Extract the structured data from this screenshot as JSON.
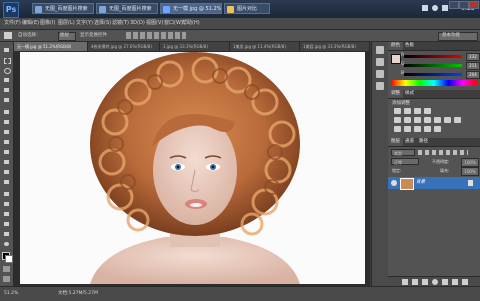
{
  "taskbar": {
    "app_logo": "Ps",
    "tabs": [
      {
        "label": "无图_百度图片搜索"
      },
      {
        "label": "无图_百度图片搜索"
      },
      {
        "label": "无一模 jpg @ 51.2%"
      },
      {
        "label": "图片对比"
      }
    ],
    "clock": "0:23"
  },
  "menubar": {
    "items": [
      "文件(F)",
      "编辑(E)",
      "图像(I)",
      "图层(L)",
      "文字(Y)",
      "选择(S)",
      "滤镜(T)",
      "3D(D)",
      "视图(V)",
      "窗口(W)",
      "帮助(H)"
    ]
  },
  "optbar": {
    "auto_select_label": "自动选择：",
    "auto_select_value": "图层",
    "transform_label": "显示变换控件",
    "workspace": "基本功能"
  },
  "doctabs": [
    {
      "label": "无一模.jpg @ 51.2%(RGB/8)",
      "active": true
    },
    {
      "label": "4卷发模特.jpg @ 27.6%(RGB/8)",
      "active": false
    },
    {
      "label": "1.jpg @ 33.3%(RGB/8)",
      "active": false
    },
    {
      "label": "1美发.jpg @ 11.4%(RGB/8)",
      "active": false
    },
    {
      "label": "1美容.jpg @ 33.3%(RGB/8)",
      "active": false
    }
  ],
  "color_panel": {
    "tabs": [
      "颜色",
      "色板"
    ],
    "r": "232",
    "g": "211",
    "b": "204"
  },
  "adjust_panel": {
    "tabs": [
      "调整",
      "样式"
    ],
    "title": "添加调整"
  },
  "layers_panel": {
    "tabs": [
      "图层",
      "通道",
      "路径"
    ],
    "kind_label": "类型",
    "mode_label": "正常",
    "opacity_label": "不透明度:",
    "opacity_value": "100%",
    "lock_label": "锁定:",
    "fill_label": "填充:",
    "fill_value": "100%",
    "layer_name": "背景"
  },
  "statusbar": {
    "zoom": "51.2%",
    "doc_label": "文档:5.27M/5.27M"
  },
  "colors": {
    "accent": "#3872b8",
    "canvas_bg": "#fbfbfb",
    "hair": "#b86a3a"
  }
}
